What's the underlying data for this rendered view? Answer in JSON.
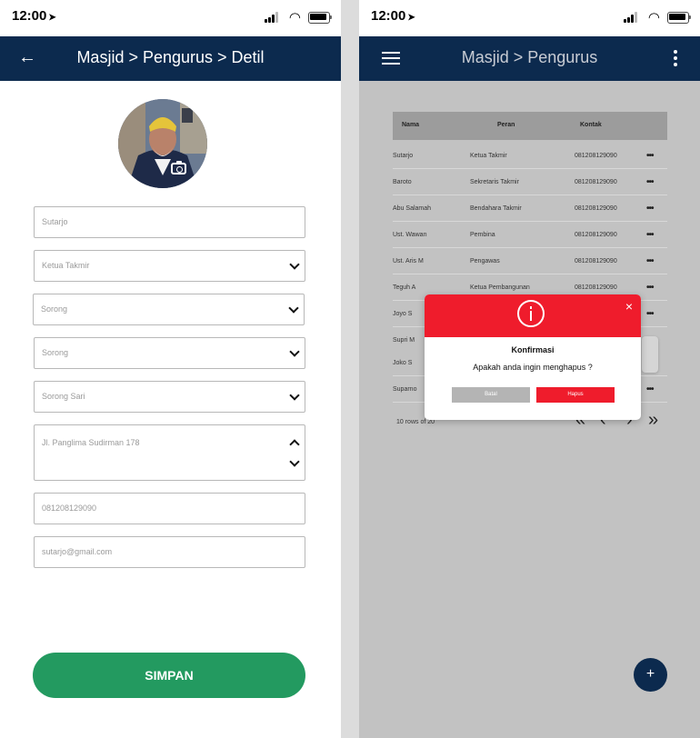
{
  "left_screen": {
    "status": {
      "time": "12:00"
    },
    "appbar": {
      "title": "Masjid > Pengurus > Detil",
      "back_icon": "arrow-left-icon"
    },
    "form": {
      "name": "Sutarjo",
      "role": "Ketua Takmir",
      "city": "Sorong",
      "district": "Sorong",
      "subdistrict": "Sorong Sari",
      "address": "Jl. Panglima Sudirman 178",
      "phone": "081208129090",
      "email": "sutarjo@gmail.com"
    },
    "save_button": "SIMPAN"
  },
  "right_screen": {
    "status": {
      "time": "12:00"
    },
    "appbar": {
      "title": "Masjid > Pengurus",
      "menu_icon": "hamburger-icon",
      "more_icon": "kebab-icon"
    },
    "table": {
      "columns": [
        "Nama",
        "Peran",
        "Kontak"
      ],
      "rows": [
        {
          "name": "Sutarjo",
          "role": "Ketua Takmir",
          "contact": "081208129090",
          "action": "•••"
        },
        {
          "name": "Baroto",
          "role": "Sekretaris Takmir",
          "contact": "081208129090",
          "action": "•••"
        },
        {
          "name": "Abu Salamah",
          "role": "Bendahara Takmir",
          "contact": "081208129090",
          "action": "•••"
        },
        {
          "name": "Ust. Wawan",
          "role": "Pembina",
          "contact": "081208129090",
          "action": "•••"
        },
        {
          "name": "Ust. Aris M",
          "role": "Pengawas",
          "contact": "081208129090",
          "action": "•••"
        },
        {
          "name": "Teguh A",
          "role": "Ketua Pembangunan",
          "contact": "081208129090",
          "action": "•••"
        },
        {
          "name": "Joyo S",
          "role": "",
          "contact": "",
          "action": "•••"
        },
        {
          "name": "Supri M",
          "role": "",
          "contact": "",
          "action": "•••"
        },
        {
          "name": "Joko S",
          "role": "",
          "contact": "",
          "action": ""
        },
        {
          "name": "Suparno",
          "role": "",
          "contact": "",
          "action": "•••"
        }
      ]
    },
    "pager": {
      "info": "10 rows of 20",
      "first": "«",
      "prev": "‹",
      "next": "›",
      "last": "»"
    },
    "fab": "+",
    "dialog": {
      "title": "Konfirmasi",
      "message": "Apakah anda ingin menghapus ?",
      "cancel": "Batal",
      "confirm": "Hapus",
      "close": "×"
    }
  }
}
